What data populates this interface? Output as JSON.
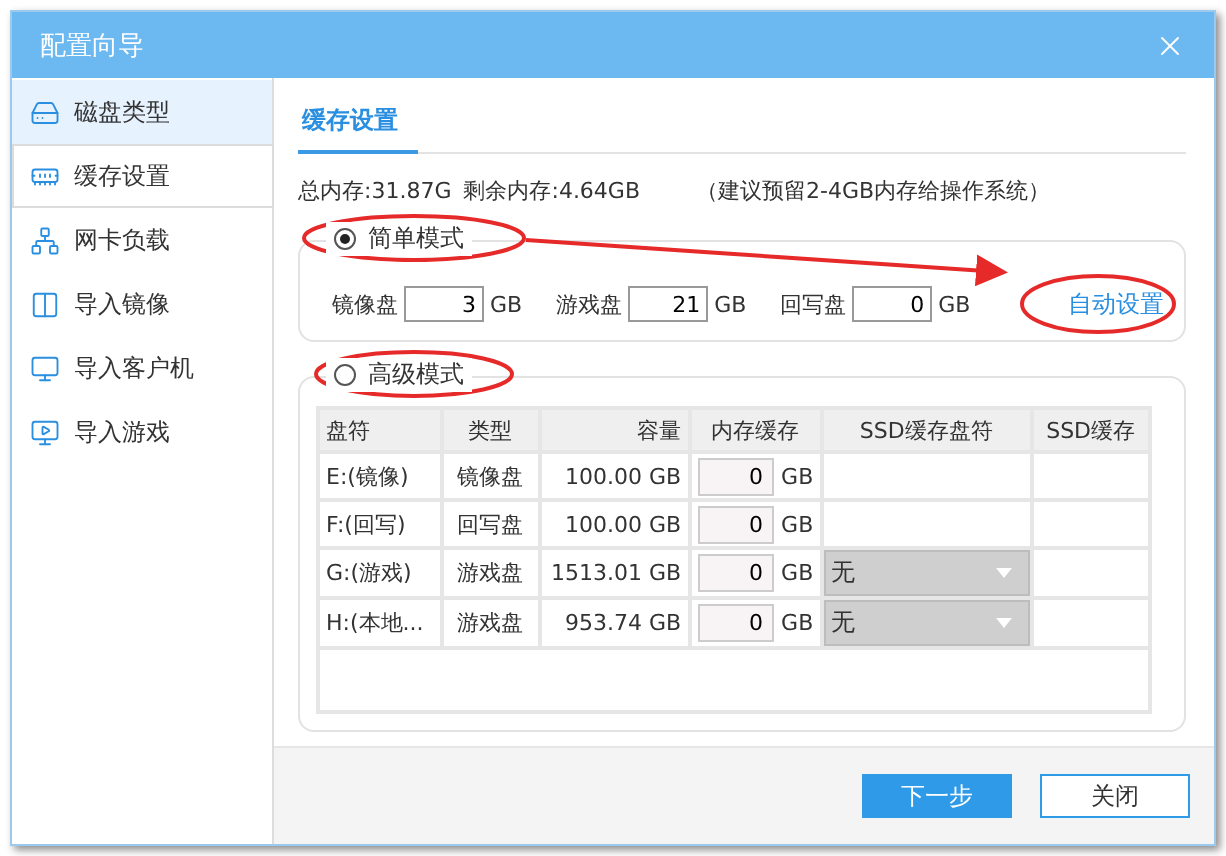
{
  "window": {
    "title": "配置向导"
  },
  "sidebar": {
    "items": [
      {
        "label": "磁盘类型",
        "selected": false,
        "hovered": true
      },
      {
        "label": "缓存设置",
        "selected": true,
        "hovered": false
      },
      {
        "label": "网卡负载",
        "selected": false,
        "hovered": false
      },
      {
        "label": "导入镜像",
        "selected": false,
        "hovered": false
      },
      {
        "label": "导入客户机",
        "selected": false,
        "hovered": false
      },
      {
        "label": "导入游戏",
        "selected": false,
        "hovered": false
      }
    ]
  },
  "tabs": [
    {
      "label": "缓存设置",
      "selected": true
    }
  ],
  "memory_info": {
    "total": "总内存:31.87G",
    "free": "剩余内存:4.64GB",
    "hint": "（建议预留2-4GB内存给操作系统）"
  },
  "simple_mode": {
    "label": "简单模式",
    "selected": true,
    "fields": [
      {
        "label": "镜像盘",
        "value": "3",
        "unit": "GB"
      },
      {
        "label": "游戏盘",
        "value": "21",
        "unit": "GB"
      },
      {
        "label": "回写盘",
        "value": "0",
        "unit": "GB"
      }
    ],
    "auto_link": "自动设置"
  },
  "advanced_mode": {
    "label": "高级模式",
    "selected": false,
    "columns": [
      "盘符",
      "类型",
      "容量",
      "内存缓存",
      "SSD缓存盘符",
      "SSD缓存"
    ],
    "rows": [
      {
        "drive": "E:(镜像)",
        "type": "镜像盘",
        "size": "100.00 GB",
        "cache": "0",
        "cache_unit": "GB"
      },
      {
        "drive": "F:(回写)",
        "type": "回写盘",
        "size": "100.00 GB",
        "cache": "0",
        "cache_unit": "GB"
      },
      {
        "drive": "G:(游戏)",
        "type": "游戏盘",
        "size": "1513.01 GB",
        "cache": "0",
        "cache_unit": "GB",
        "ssd_select": {
          "value": "无",
          "disabled": true
        }
      },
      {
        "drive": "H:(本地...",
        "type": "游戏盘",
        "size": "953.74 GB",
        "cache": "0",
        "cache_unit": "GB",
        "ssd_select": {
          "value": "无",
          "disabled": true
        }
      }
    ]
  },
  "buttons": [
    {
      "label": "下一步",
      "kind": "primary"
    },
    {
      "label": "关闭",
      "kind": "secondary"
    }
  ]
}
